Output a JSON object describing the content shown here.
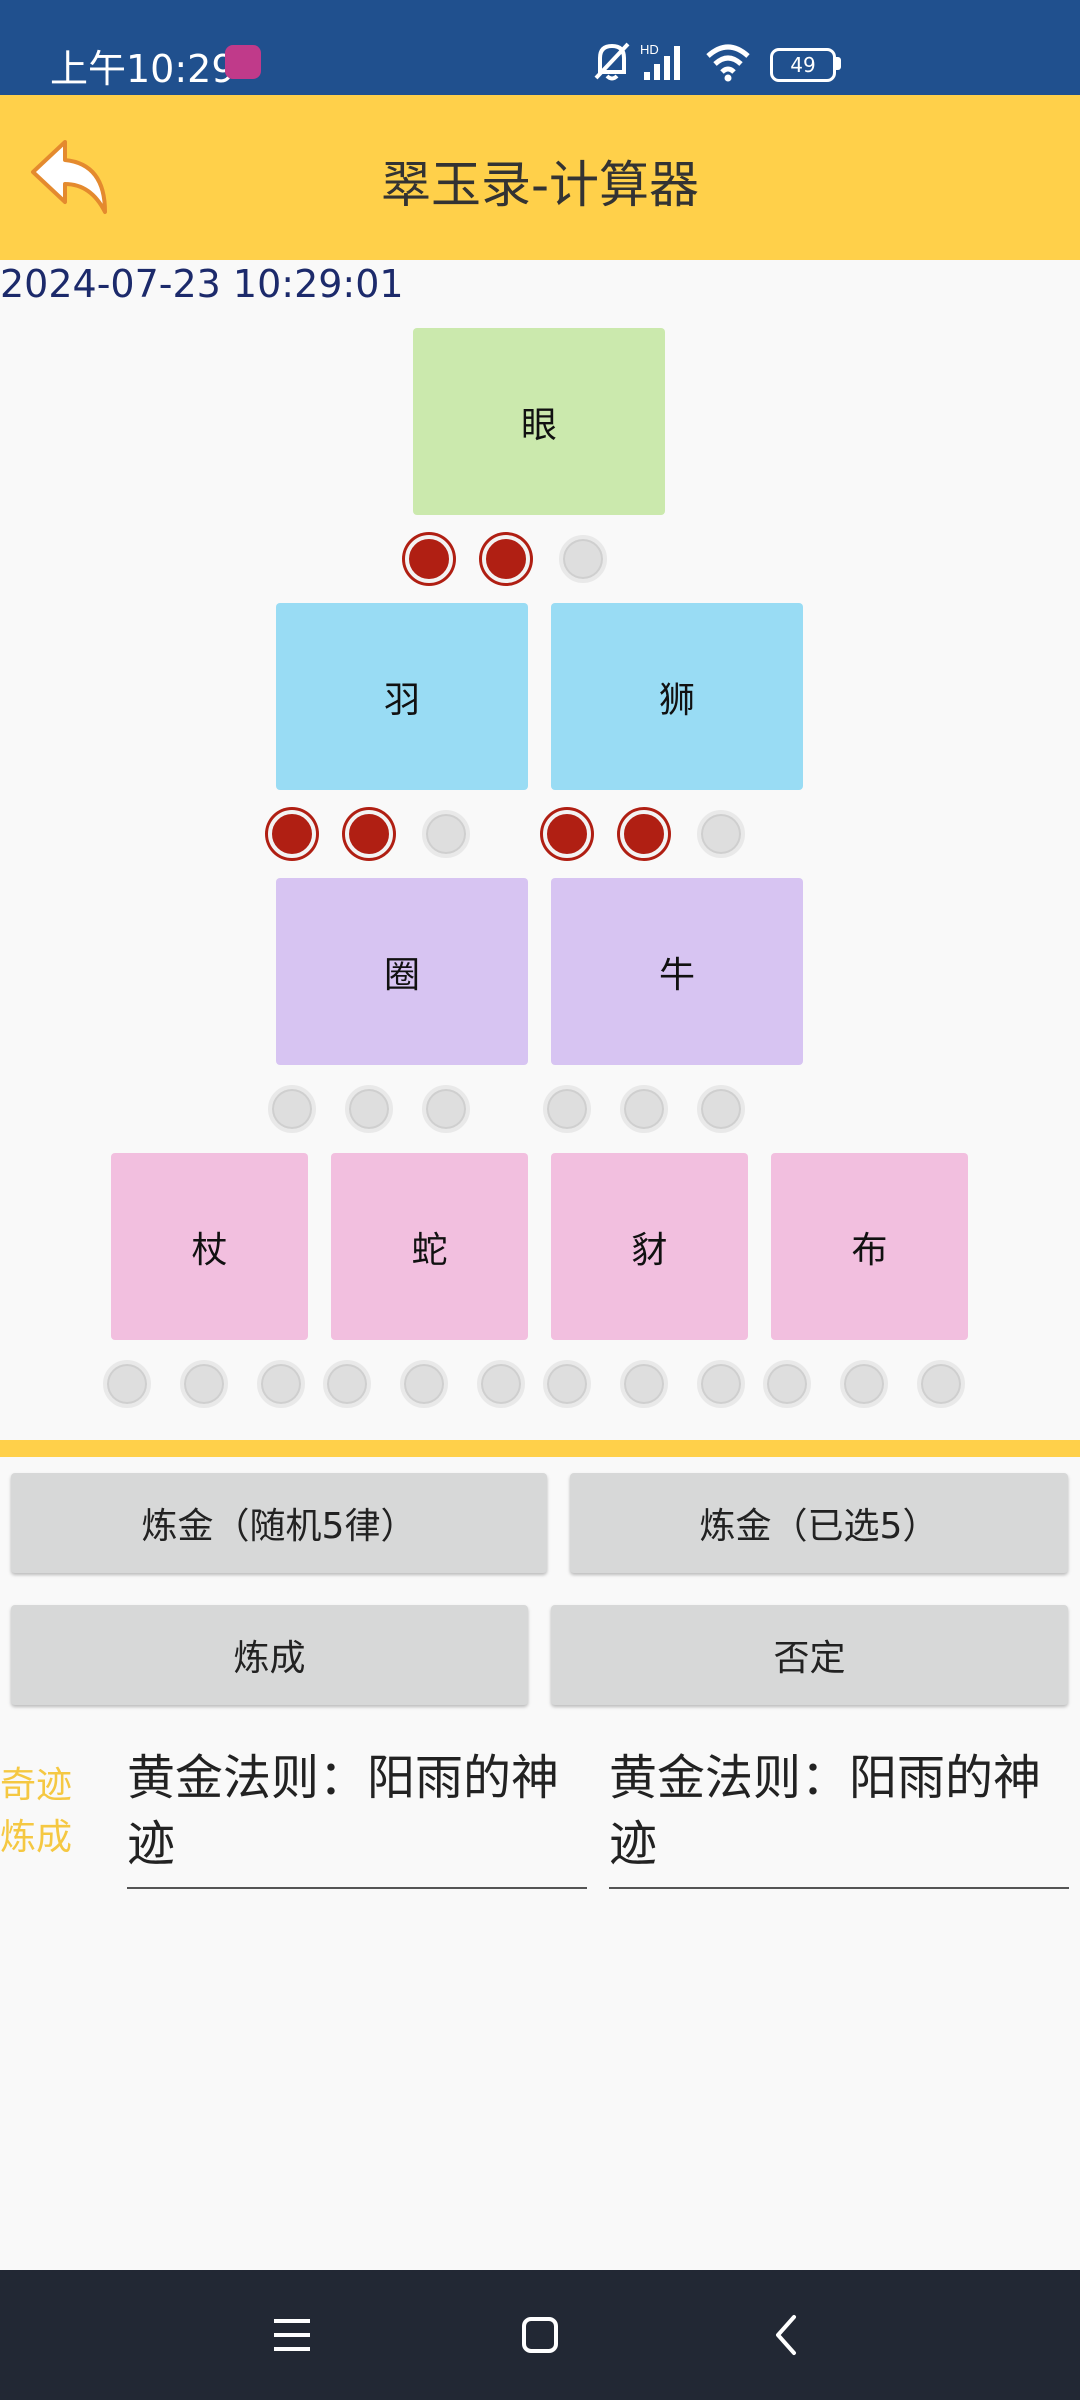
{
  "status_bar": {
    "time": "上午10:29",
    "battery": "49"
  },
  "app_bar": {
    "title": "翠玉录-计算器",
    "back_icon": "back-arrow-icon"
  },
  "timestamp": "2024-07-23 10:29:01",
  "tiles": {
    "row1": [
      "眼"
    ],
    "row2": [
      "羽",
      "狮"
    ],
    "row3": [
      "圈",
      "牛"
    ],
    "row4": [
      "杖",
      "蛇",
      "豺",
      "布"
    ]
  },
  "selectors": {
    "eye": [
      true,
      true,
      false
    ],
    "feather": [
      true,
      true,
      false
    ],
    "lion": [
      true,
      true,
      false
    ],
    "circle": [
      false,
      false,
      false
    ],
    "ox": [
      false,
      false,
      false
    ],
    "staff": [
      false,
      false,
      false
    ],
    "snake": [
      false,
      false,
      false
    ],
    "jackal": [
      false,
      false,
      false
    ],
    "cloth": [
      false,
      false,
      false
    ]
  },
  "buttons": {
    "alchemy_random": "炼金（随机5律）",
    "alchemy_selected": "炼金（已选5）",
    "complete": "炼成",
    "negate": "否定"
  },
  "result": {
    "label": "奇迹炼成",
    "left": "黄金法则：阳雨的神迹",
    "right": "黄金法则：阳雨的神迹"
  },
  "colors": {
    "accent": "#ffd04a",
    "status_bar": "#20508e",
    "selected_dot": "#b01f13",
    "tile_green": "#cbe9ad",
    "tile_blue": "#99dcf4",
    "tile_purple": "#d7c4f2",
    "tile_pink": "#f2bfdf"
  },
  "nav_bar": {
    "icons": [
      "menu-icon",
      "home-icon",
      "back-icon"
    ]
  }
}
